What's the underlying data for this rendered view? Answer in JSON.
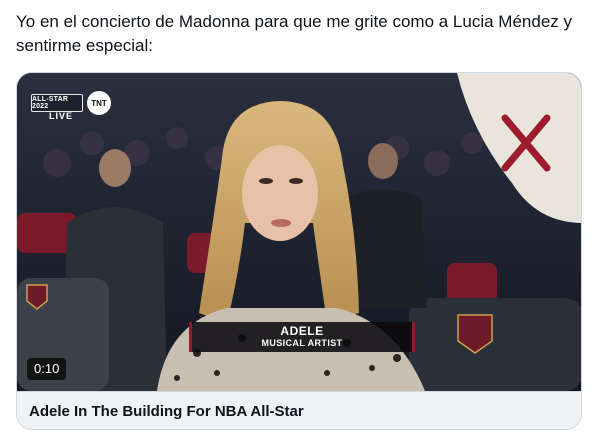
{
  "tweet": {
    "text": "Yo en el concierto de Madonna para que me grite como a Lucia Méndez y sentirme especial:"
  },
  "video": {
    "broadcast_logo": "ALL-STAR 2022",
    "network_logo": "TNT",
    "live_label": "LIVE",
    "lower_third_name": "ADELE",
    "lower_third_role": "MUSICAL ARTIST",
    "duration": "0:10",
    "play_state": "paused"
  },
  "card": {
    "title": "Adele In The Building For NBA All-Star"
  },
  "colors": {
    "text": "#0f1419",
    "border": "#cfd9de",
    "caption_bg": "#eef2f5",
    "cavs_wine": "#8b1c2a"
  },
  "icons": [
    "nba-allstar-logo-icon",
    "tnt-logo-icon",
    "cavaliers-logo-icon"
  ]
}
